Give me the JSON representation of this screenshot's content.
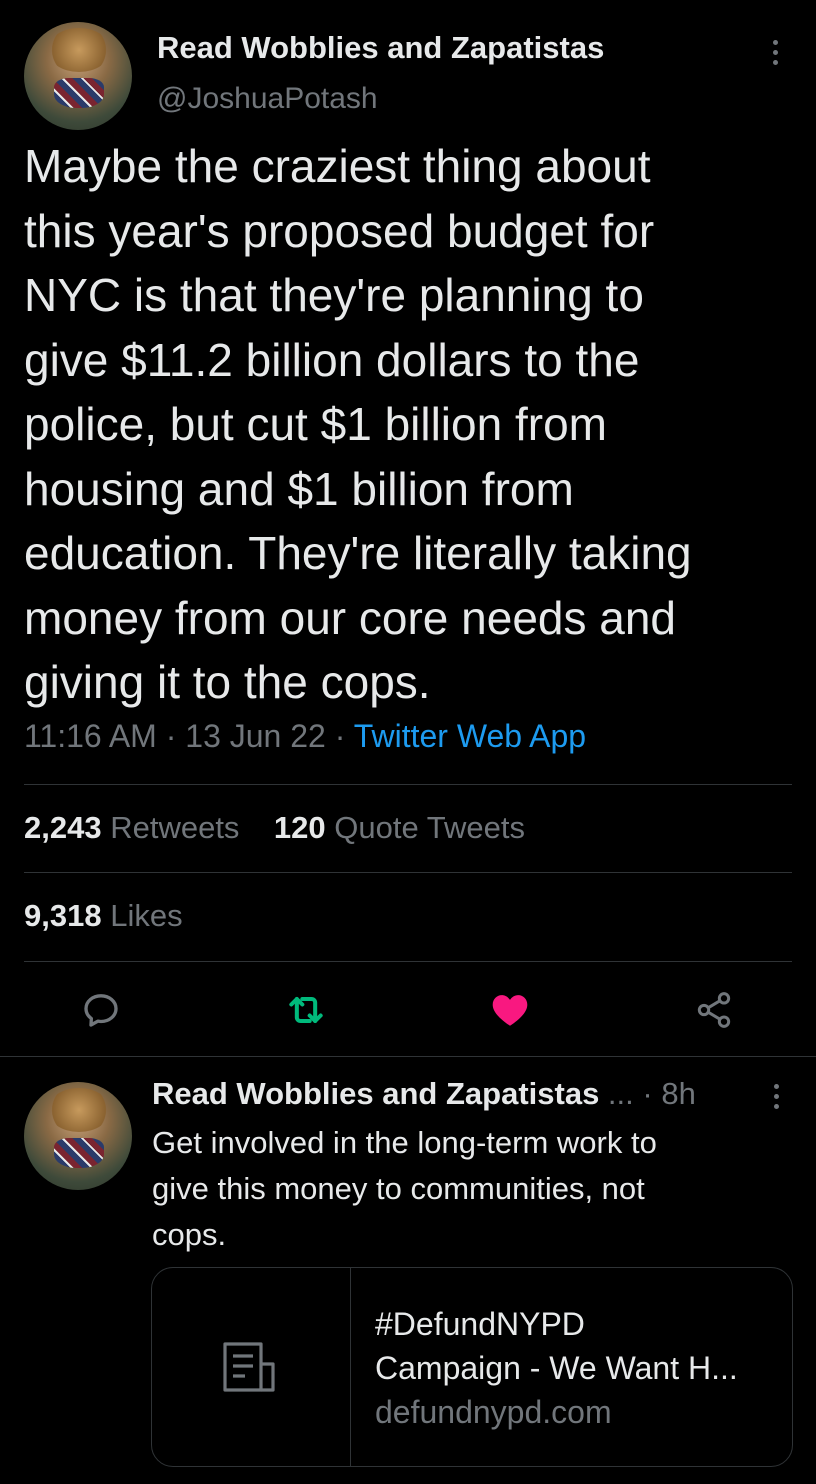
{
  "main_tweet": {
    "display_name": "Read Wobblies and Zapatistas",
    "handle": "@JoshuaPotash",
    "text": "Maybe the craziest thing about\nthis year's proposed budget for\nNYC is that they're planning to\ngive $11.2 billion dollars to the\npolice, but cut $1 billion from\nhousing and $1 billion from\neducation. They're literally taking\nmoney from our core needs and\ngiving it to the cops.",
    "time": "11:16 AM",
    "sep1": " · ",
    "date": "13 Jun 22",
    "sep2": " · ",
    "source": "Twitter Web App",
    "retweets_count": "2,243",
    "retweets_label": "Retweets",
    "quotes_count": "120",
    "quotes_label": "Quote Tweets",
    "likes_count": "9,318",
    "likes_label": "Likes",
    "liked": true
  },
  "reply": {
    "display_name": "Read Wobblies and Zapatistas",
    "truncation": " ...",
    "separator": " · ",
    "time": "8h",
    "text": "Get involved in the long-term work to\ngive this money to communities, not\ncops.",
    "card": {
      "title": "#DefundNYPD\nCampaign - We Want H...",
      "domain": "defundnypd.com"
    }
  },
  "colors": {
    "background": "#000000",
    "text": "#e7e9ea",
    "secondary": "#71767b",
    "link": "#1d9bf0",
    "retweet": "#00ba7c",
    "like": "#f91880",
    "border": "#2f3336"
  },
  "icons": {
    "reply": "reply-icon",
    "retweet": "retweet-icon",
    "like": "heart-icon",
    "share": "share-icon",
    "more": "more-vertical-icon",
    "card": "document-icon"
  }
}
